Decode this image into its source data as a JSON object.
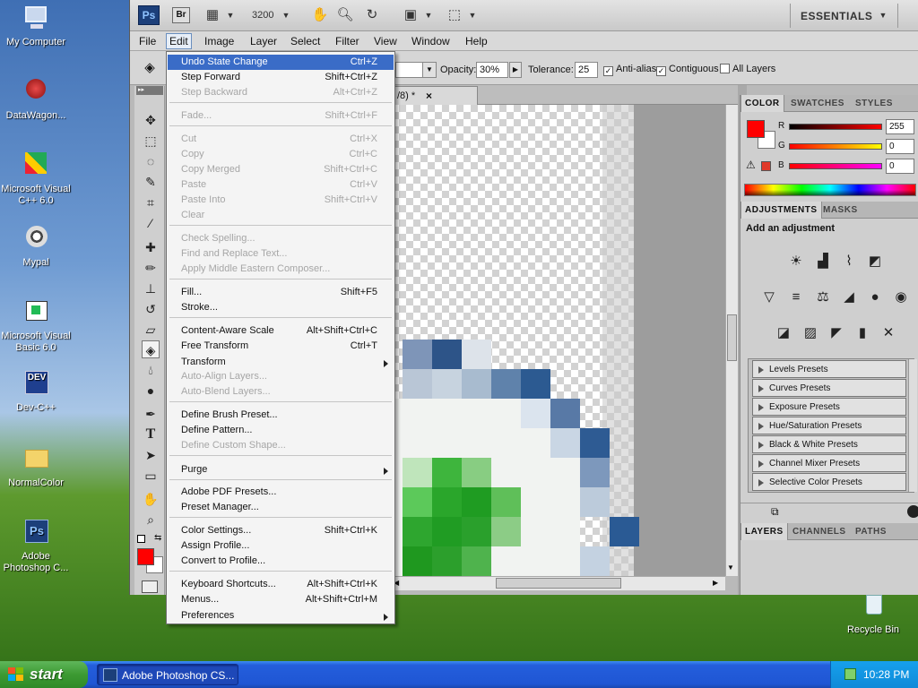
{
  "desktop": {
    "icons": [
      {
        "label": "My Computer"
      },
      {
        "label": "DataWagon..."
      },
      {
        "label": "Microsoft Visual C++ 6.0"
      },
      {
        "label": "Mypal"
      },
      {
        "label": "Microsoft Visual Basic 6.0"
      },
      {
        "label": "Dev-C++"
      },
      {
        "label": "NormalColor"
      },
      {
        "label": "Adobe Photoshop C..."
      },
      {
        "label": "Recycle Bin"
      }
    ]
  },
  "taskbar": {
    "start_label": "start",
    "task_label": "Adobe Photoshop CS...",
    "clock": "10:28 PM"
  },
  "app": {
    "ps_badge": "Ps",
    "br_badge": "Br",
    "zoom": "3200",
    "workspace": "ESSENTIALS",
    "menus": [
      "File",
      "Edit",
      "Image",
      "Layer",
      "Select",
      "Filter",
      "View",
      "Window",
      "Help"
    ],
    "options": {
      "opacity_label": "Opacity:",
      "opacity_value": "30%",
      "tolerance_label": "Tolerance:",
      "tolerance_value": "25",
      "antialias_label": "Anti-alias",
      "contiguous_label": "Contiguous",
      "all_layers_label": "All Layers"
    },
    "doc_tab": "/8) *",
    "doc_close": "×"
  },
  "edit_menu": {
    "items": [
      {
        "label": "Undo State Change",
        "shortcut": "Ctrl+Z"
      },
      {
        "label": "Step Forward",
        "shortcut": "Shift+Ctrl+Z"
      },
      {
        "label": "Step Backward",
        "shortcut": "Alt+Ctrl+Z"
      },
      {
        "label": "Fade...",
        "shortcut": "Shift+Ctrl+F"
      },
      {
        "label": "Cut",
        "shortcut": "Ctrl+X"
      },
      {
        "label": "Copy",
        "shortcut": "Ctrl+C"
      },
      {
        "label": "Copy Merged",
        "shortcut": "Shift+Ctrl+C"
      },
      {
        "label": "Paste",
        "shortcut": "Ctrl+V"
      },
      {
        "label": "Paste Into",
        "shortcut": "Shift+Ctrl+V"
      },
      {
        "label": "Clear",
        "shortcut": ""
      },
      {
        "label": "Check Spelling...",
        "shortcut": ""
      },
      {
        "label": "Find and Replace Text...",
        "shortcut": ""
      },
      {
        "label": "Apply Middle Eastern Composer...",
        "shortcut": ""
      },
      {
        "label": "Fill...",
        "shortcut": "Shift+F5"
      },
      {
        "label": "Stroke...",
        "shortcut": ""
      },
      {
        "label": "Content-Aware Scale",
        "shortcut": "Alt+Shift+Ctrl+C"
      },
      {
        "label": "Free Transform",
        "shortcut": "Ctrl+T"
      },
      {
        "label": "Transform",
        "shortcut": ""
      },
      {
        "label": "Auto-Align Layers...",
        "shortcut": ""
      },
      {
        "label": "Auto-Blend Layers...",
        "shortcut": ""
      },
      {
        "label": "Define Brush Preset...",
        "shortcut": ""
      },
      {
        "label": "Define Pattern...",
        "shortcut": ""
      },
      {
        "label": "Define Custom Shape...",
        "shortcut": ""
      },
      {
        "label": "Purge",
        "shortcut": ""
      },
      {
        "label": "Adobe PDF Presets...",
        "shortcut": ""
      },
      {
        "label": "Preset Manager...",
        "shortcut": ""
      },
      {
        "label": "Color Settings...",
        "shortcut": "Shift+Ctrl+K"
      },
      {
        "label": "Assign Profile...",
        "shortcut": ""
      },
      {
        "label": "Convert to Profile...",
        "shortcut": ""
      },
      {
        "label": "Keyboard Shortcuts...",
        "shortcut": "Alt+Shift+Ctrl+K"
      },
      {
        "label": "Menus...",
        "shortcut": "Alt+Shift+Ctrl+M"
      },
      {
        "label": "Preferences",
        "shortcut": ""
      }
    ]
  },
  "panels": {
    "color_tabs": [
      "COLOR",
      "SWATCHES",
      "STYLES"
    ],
    "rgb": {
      "r_label": "R",
      "g_label": "G",
      "b_label": "B",
      "r": "255",
      "g": "0",
      "b": "0"
    },
    "adj_tabs": [
      "ADJUSTMENTS",
      "MASKS"
    ],
    "adj_title": "Add an adjustment",
    "presets": [
      "Levels Presets",
      "Curves Presets",
      "Exposure Presets",
      "Hue/Saturation Presets",
      "Black & White Presets",
      "Channel Mixer Presets",
      "Selective Color Presets"
    ],
    "layer_tabs": [
      "LAYERS",
      "CHANNELS",
      "PATHS"
    ],
    "fg_color": "#ff0000",
    "bg_color": "#ffffff"
  }
}
